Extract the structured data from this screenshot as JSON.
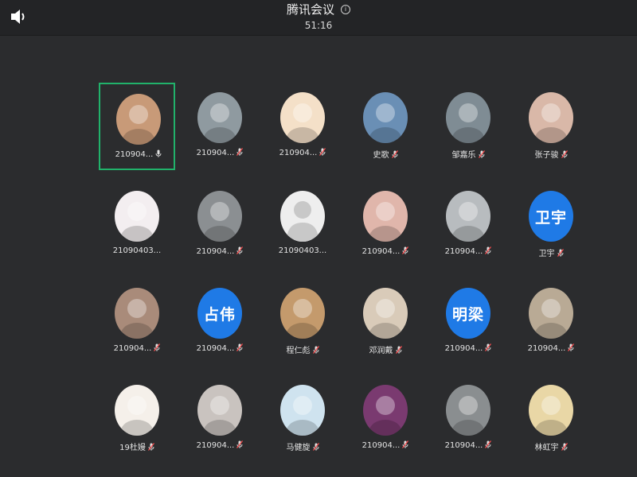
{
  "header": {
    "title": "腾讯会议",
    "timer": "51:16",
    "info_glyph": "i"
  },
  "participants": [
    {
      "name": "210904...",
      "avatar": "photo",
      "color": "#c89a78",
      "mic": "on",
      "selected": true
    },
    {
      "name": "210904...",
      "avatar": "photo",
      "color": "#8f9aa0",
      "mic": "muted"
    },
    {
      "name": "210904...",
      "avatar": "photo",
      "color": "#f4e0c8",
      "mic": "muted"
    },
    {
      "name": "史歌",
      "avatar": "photo",
      "color": "#6a8fb5",
      "mic": "muted"
    },
    {
      "name": "邹嘉乐",
      "avatar": "photo",
      "color": "#7f8c94",
      "mic": "muted"
    },
    {
      "name": "张子骏",
      "avatar": "photo",
      "color": "#d9b8a8",
      "mic": "muted"
    },
    {
      "name": "21090403...",
      "avatar": "photo",
      "color": "#f3eef0",
      "mic": "none"
    },
    {
      "name": "210904...",
      "avatar": "photo",
      "color": "#8b8f92",
      "mic": "muted"
    },
    {
      "name": "21090403...",
      "avatar": "placeholder",
      "color": "#eeeeee",
      "mic": "none"
    },
    {
      "name": "210904...",
      "avatar": "photo",
      "color": "#e0b6ab",
      "mic": "muted"
    },
    {
      "name": "210904...",
      "avatar": "photo",
      "color": "#b8bcbf",
      "mic": "muted"
    },
    {
      "name": "卫宇",
      "avatar": "text",
      "avatar_text": "卫宇",
      "color": "#1f7ae6",
      "mic": "muted"
    },
    {
      "name": "210904...",
      "avatar": "photo",
      "color": "#a98b7a",
      "mic": "muted"
    },
    {
      "name": "210904...",
      "avatar": "text",
      "avatar_text": "占伟",
      "color": "#1f7ae6",
      "mic": "muted"
    },
    {
      "name": "程仁彪",
      "avatar": "photo",
      "color": "#c49a6c",
      "mic": "muted"
    },
    {
      "name": "邓润戴",
      "avatar": "photo",
      "color": "#d9cbb9",
      "mic": "muted"
    },
    {
      "name": "210904...",
      "avatar": "text",
      "avatar_text": "明梁",
      "color": "#1f7ae6",
      "mic": "muted"
    },
    {
      "name": "210904...",
      "avatar": "photo",
      "color": "#b9aa95",
      "mic": "muted"
    },
    {
      "name": "19杜嫚",
      "avatar": "photo",
      "color": "#f5f0ea",
      "mic": "muted"
    },
    {
      "name": "210904...",
      "avatar": "photo",
      "color": "#c9c3bf",
      "mic": "muted"
    },
    {
      "name": "马健旋",
      "avatar": "photo",
      "color": "#cfe3ef",
      "mic": "muted"
    },
    {
      "name": "210904...",
      "avatar": "photo",
      "color": "#7a3a70",
      "mic": "muted"
    },
    {
      "name": "210904...",
      "avatar": "photo",
      "color": "#8a8e90",
      "mic": "muted"
    },
    {
      "name": "林虹宇",
      "avatar": "photo",
      "color": "#e9d7a6",
      "mic": "muted"
    }
  ]
}
